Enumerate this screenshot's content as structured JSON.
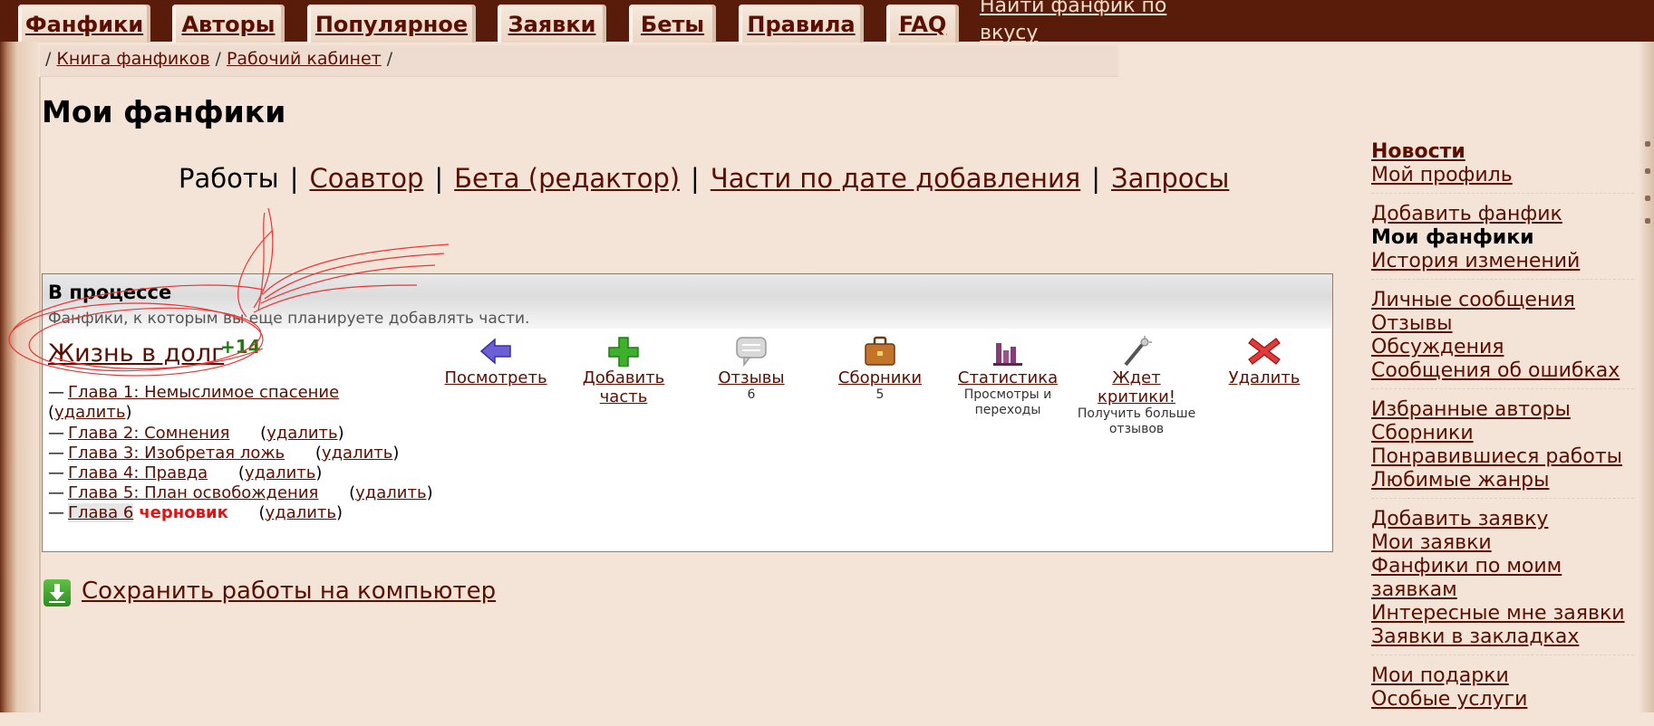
{
  "topnav": {
    "tabs": [
      "Фанфики",
      "Авторы",
      "Популярное",
      "Заявки",
      "Беты",
      "Правила",
      "FAQ"
    ],
    "find_link": "Найти фанфик по вкусу"
  },
  "breadcrumb": {
    "items": [
      "Книга фанфиков",
      "Рабочий кабинет"
    ]
  },
  "page_title": "Мои фанфики",
  "subnav": {
    "current": "Работы",
    "links": [
      "Соавтор",
      "Бета (редактор)",
      "Части по дате добавления",
      "Запросы"
    ]
  },
  "section": {
    "title": "В процессе",
    "subtitle": "Фанфики, к которым вы еще планируете добавлять части.",
    "story": {
      "title": "Жизнь в долг",
      "score": "+14",
      "delete_label": "удалить",
      "chapters": [
        "Глава 1: Немыслимое спасение",
        "Глава 2: Сомнения",
        "Глава 3: Изобретая ложь",
        "Глава 4: Правда",
        "Глава 5: План освобождения",
        "Глава 6"
      ],
      "draft_label": "черновик"
    },
    "actions": [
      {
        "label": "Посмотреть",
        "sub": ""
      },
      {
        "label": "Добавить часть",
        "sub": ""
      },
      {
        "label": "Отзывы",
        "sub": "6"
      },
      {
        "label": "Сборники",
        "sub": "5"
      },
      {
        "label": "Статистика",
        "sub": "Просмотры и переходы"
      },
      {
        "label": "Ждет критики!",
        "sub": "Получить больше отзывов"
      },
      {
        "label": "Удалить",
        "sub": ""
      }
    ]
  },
  "save_link": "Сохранить работы на компьютер",
  "sidebar": {
    "groups": [
      [
        "Новости",
        "Мой профиль"
      ],
      [
        "Добавить фанфик",
        "Мои фанфики",
        "История изменений"
      ],
      [
        "Личные сообщения",
        "Отзывы",
        "Обсуждения",
        "Сообщения об ошибках"
      ],
      [
        "Избранные авторы",
        "Сборники",
        "Понравившиеся работы",
        "Любимые жанры"
      ],
      [
        "Добавить заявку",
        "Мои заявки",
        "Фанфики по моим заявкам",
        "Интересные мне заявки",
        "Заявки в закладках"
      ],
      [
        "Мои подарки",
        "Особые услуги"
      ]
    ]
  },
  "colors": {
    "link": "#5a0f00",
    "topbar": "#5a1c0a",
    "score": "#1f7a13",
    "draft": "#e21212",
    "background": "#f4e4d8"
  }
}
